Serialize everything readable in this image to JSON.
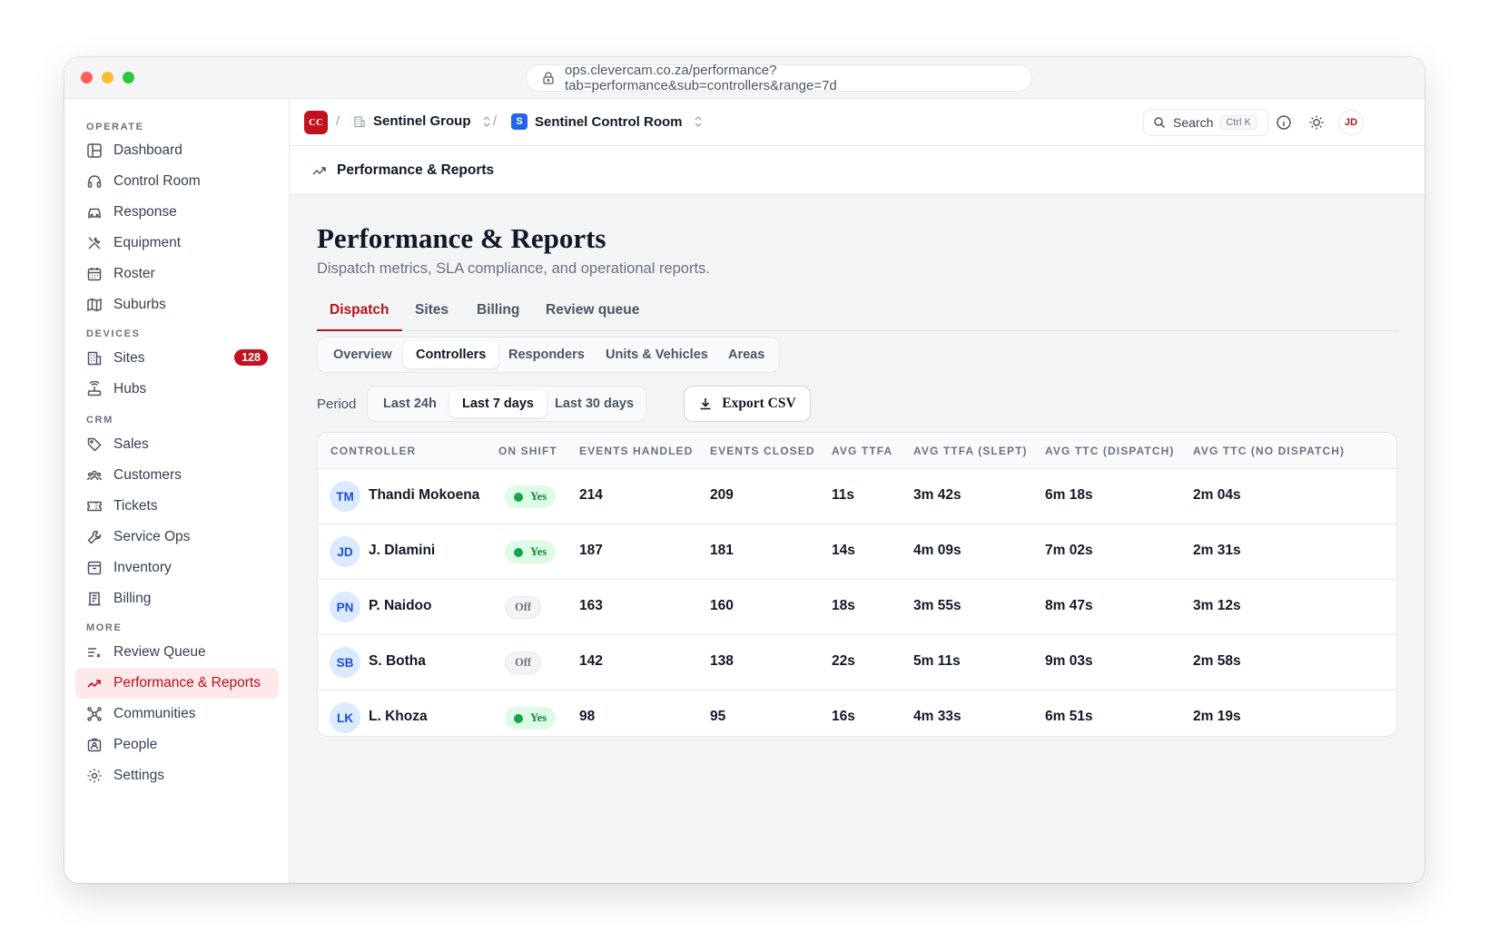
{
  "browser": {
    "url": "ops.clevercam.co.za/performance?tab=performance&sub=controllers&range=7d"
  },
  "sidebar": {
    "sections": {
      "operate": "OPERATE",
      "devices": "DEVICES",
      "crm": "CRM",
      "more": "MORE"
    },
    "items": {
      "dashboard": "Dashboard",
      "control_room": "Control Room",
      "response": "Response",
      "equipment": "Equipment",
      "roster": "Roster",
      "suburbs": "Suburbs",
      "sites": "Sites",
      "sites_badge": "128",
      "hubs": "Hubs",
      "sales": "Sales",
      "customers": "Customers",
      "tickets": "Tickets",
      "service_ops": "Service Ops",
      "inventory": "Inventory",
      "billing": "Billing",
      "review_queue": "Review Queue",
      "performance": "Performance & Reports",
      "communities": "Communities",
      "people": "People",
      "settings": "Settings"
    }
  },
  "topbar": {
    "logo": "CC",
    "sep": "/",
    "org": "Sentinel Group",
    "room_badge": "S",
    "room": "Sentinel Control Room",
    "search_label": "Search",
    "search_kbd": "Ctrl K",
    "user_initials": "JD"
  },
  "pagebar": {
    "title": "Performance & Reports"
  },
  "page": {
    "title": "Performance & Reports",
    "subtitle": "Dispatch metrics, SLA compliance, and operational reports.",
    "tabs": [
      "Dispatch",
      "Sites",
      "Billing",
      "Review queue"
    ],
    "subtabs": [
      "Overview",
      "Controllers",
      "Responders",
      "Units & Vehicles",
      "Areas"
    ],
    "period_label": "Period",
    "periods": [
      "Last 24h",
      "Last 7 days",
      "Last 30 days"
    ],
    "export_label": "Export CSV"
  },
  "table": {
    "headers": [
      "CONTROLLER",
      "ON SHIFT",
      "EVENTS HANDLED",
      "EVENTS CLOSED",
      "AVG TTFA",
      "AVG TTFA (SLEPT)",
      "AVG TTC (DISPATCH)",
      "AVG TTC (NO DISPATCH)"
    ],
    "rows": [
      {
        "initials": "TM",
        "name": "Thandi Mokoena",
        "shift": "Yes",
        "handled": "214",
        "closed": "209",
        "ttfa": "11s",
        "ttfa_slept": "3m 42s",
        "ttc_dispatch": "6m 18s",
        "ttc_no_dispatch": "2m 04s"
      },
      {
        "initials": "JD",
        "name": "J. Dlamini",
        "shift": "Yes",
        "handled": "187",
        "closed": "181",
        "ttfa": "14s",
        "ttfa_slept": "4m 09s",
        "ttc_dispatch": "7m 02s",
        "ttc_no_dispatch": "2m 31s"
      },
      {
        "initials": "PN",
        "name": "P. Naidoo",
        "shift": "Off",
        "handled": "163",
        "closed": "160",
        "ttfa": "18s",
        "ttfa_slept": "3m 55s",
        "ttc_dispatch": "8m 47s",
        "ttc_no_dispatch": "3m 12s"
      },
      {
        "initials": "SB",
        "name": "S. Botha",
        "shift": "Off",
        "handled": "142",
        "closed": "138",
        "ttfa": "22s",
        "ttfa_slept": "5m 11s",
        "ttc_dispatch": "9m 03s",
        "ttc_no_dispatch": "2m 58s"
      },
      {
        "initials": "LK",
        "name": "L. Khoza",
        "shift": "Yes",
        "handled": "98",
        "closed": "95",
        "ttfa": "16s",
        "ttfa_slept": "4m 33s",
        "ttc_dispatch": "6m 51s",
        "ttc_no_dispatch": "2m 19s"
      }
    ]
  },
  "colors": {
    "accent": "#b5121b",
    "active_bg": "#fde8ea",
    "on_shift": "#16a34a",
    "avatar_bg": "#dbeafe"
  }
}
